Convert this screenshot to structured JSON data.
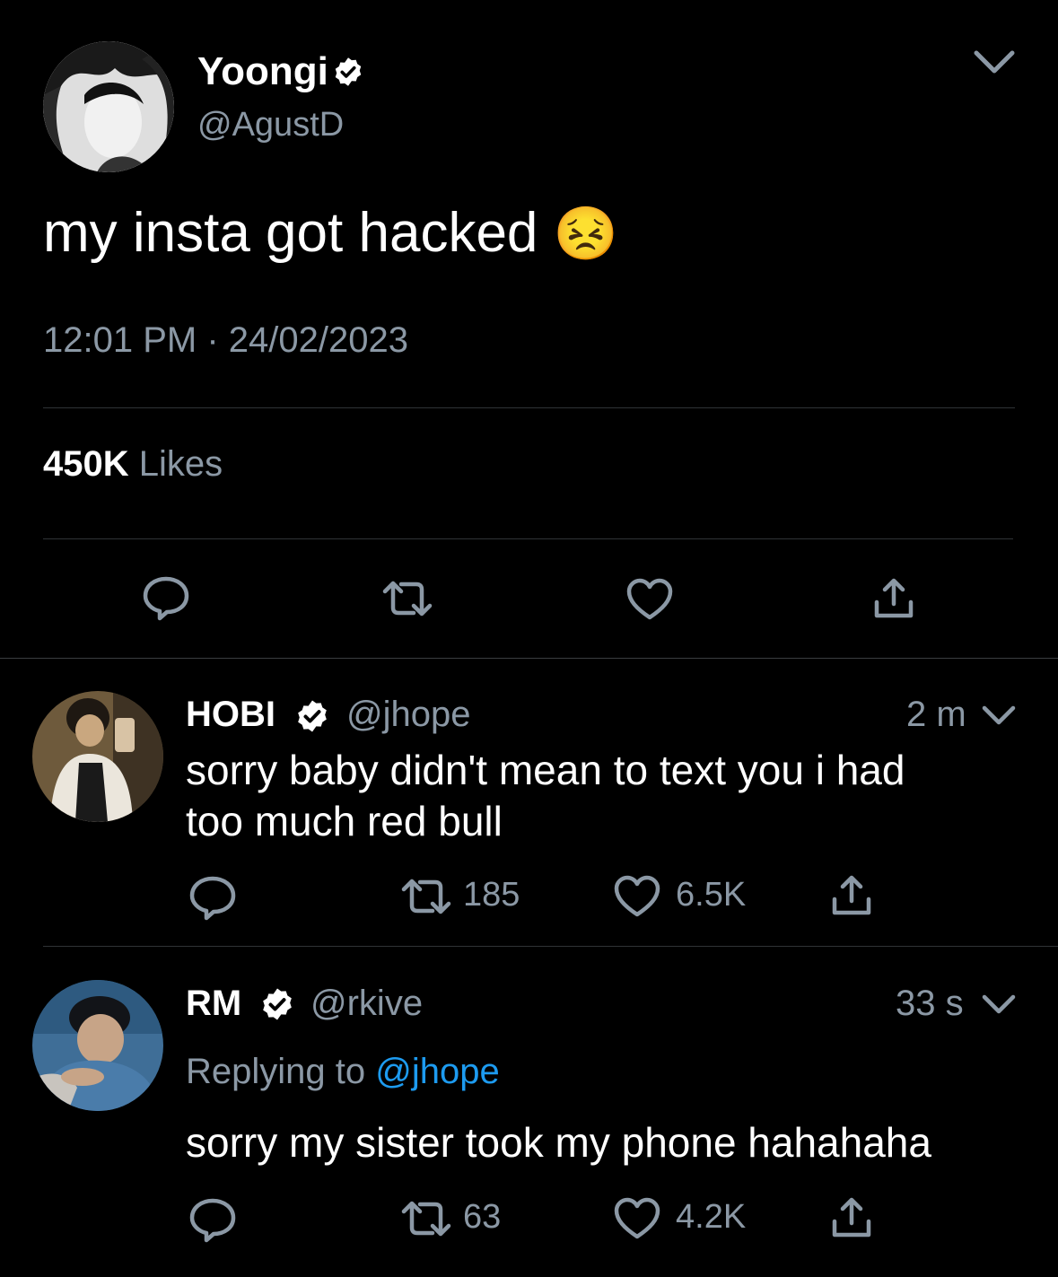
{
  "main_tweet": {
    "display_name": "Yoongi",
    "handle": "@AgustD",
    "text": "my insta got hacked",
    "emoji": "😣",
    "time": "12:01 PM",
    "separator": "·",
    "date": "24/02/2023",
    "likes_count": "450K",
    "likes_label": "Likes"
  },
  "replies": [
    {
      "display_name": "HOBI",
      "handle": "@jhope",
      "time_ago": "2 m",
      "text_line1": "sorry baby didn't mean to text you i had",
      "text_line2": "too much red bull",
      "retweets": "185",
      "likes": "6.5K"
    },
    {
      "display_name": "RM",
      "handle": "@rkive",
      "time_ago": "33 s",
      "replying_prefix": "Replying to",
      "replying_handle": "@jhope",
      "text": "sorry my sister took my phone hahahaha",
      "retweets": "63",
      "likes": "4.2K"
    }
  ],
  "colors": {
    "background": "#000000",
    "muted_text": "#8b98a5",
    "link": "#1d9bf0",
    "divider": "#2f3336"
  }
}
